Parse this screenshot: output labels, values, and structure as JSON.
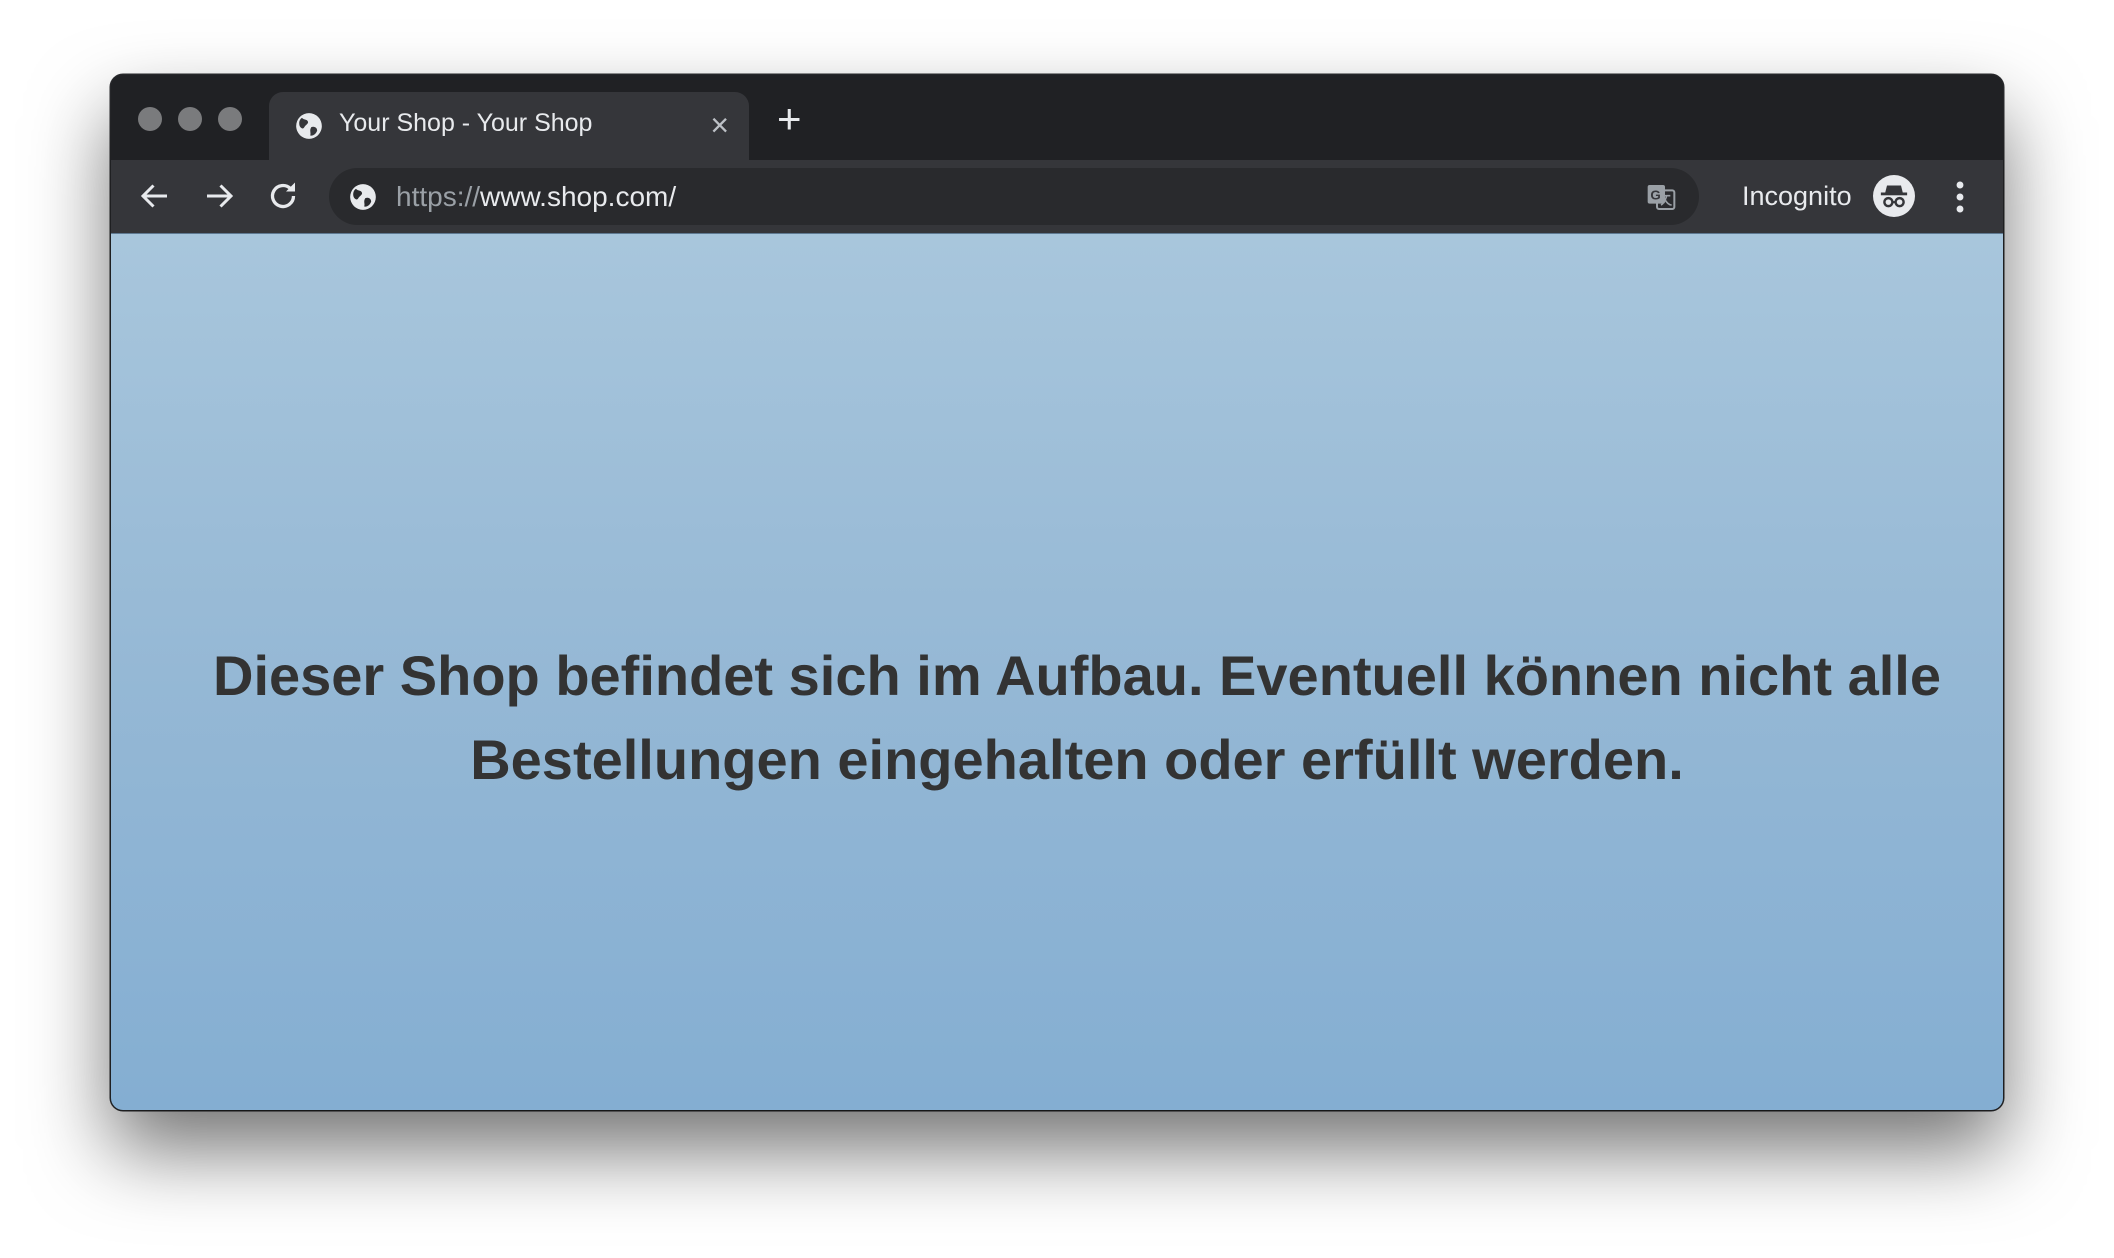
{
  "window": {
    "traffic_lights": [
      "close",
      "minimize",
      "zoom"
    ]
  },
  "tabs": [
    {
      "title": "Your Shop - Your Shop",
      "icon": "globe-icon",
      "active": true,
      "close_label": "×"
    }
  ],
  "new_tab_label": "+",
  "toolbar": {
    "back_icon": "arrow-left-icon",
    "forward_icon": "arrow-right-icon",
    "reload_icon": "reload-icon",
    "url_scheme": "https://",
    "url_host": "www.shop.com/",
    "site_info_icon": "globe-icon",
    "translate_icon": "translate-icon",
    "profile_label": "Incognito",
    "profile_icon": "incognito-icon",
    "menu_icon": "more-vert-icon"
  },
  "page": {
    "message": "Dieser Shop befindet sich im Aufbau. Eventuell können nicht alle Bestellungen eingehalten oder erfüllt werden.",
    "colors": {
      "background_top": "#a8c6dc",
      "background_bottom": "#84aed2",
      "text": "#333333"
    }
  }
}
